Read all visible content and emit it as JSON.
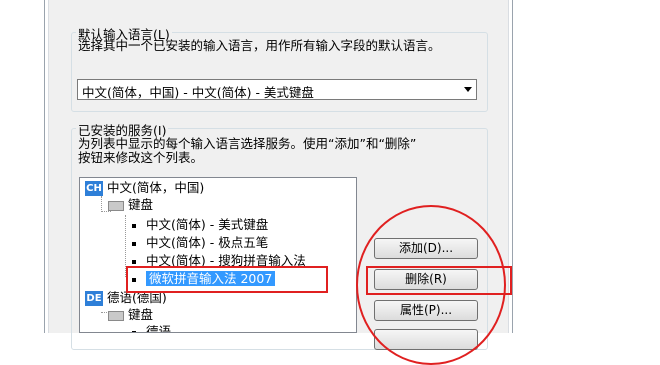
{
  "default_lang": {
    "group_title": "默认输入语言(L)",
    "description": "选择其中一个已安装的输入语言，用作所有输入字段的默认语言。",
    "selected_value": "中文(简体，中国) - 中文(简体) - 美式键盘"
  },
  "services": {
    "group_title": "已安装的服务(I)",
    "description_line1": "为列表中显示的每个输入语言选择服务。使用“添加”和“删除”",
    "description_line2": "按钮来修改这个列表。",
    "tree": {
      "lang1": {
        "tag": "CH",
        "label": "中文(简体，中国)"
      },
      "lang1_keyboard": "键盘",
      "lang1_items": [
        "中文(简体) - 美式键盘",
        "中文(简体) - 极点五笔",
        "中文(简体) - 搜狗拼音输入法",
        "微软拼音输入法 2007"
      ],
      "lang2": {
        "tag": "DE",
        "label": "德语(德国)"
      },
      "lang2_keyboard": "键盘",
      "lang2_items": [
        "德语"
      ]
    }
  },
  "buttons": {
    "add": "添加(D)...",
    "remove": "删除(R)",
    "properties": "属性(P)..."
  },
  "colors": {
    "highlight_red": "#e02020",
    "selection_blue": "#3399ff",
    "lang_tag_blue": "#2e7fd8"
  }
}
